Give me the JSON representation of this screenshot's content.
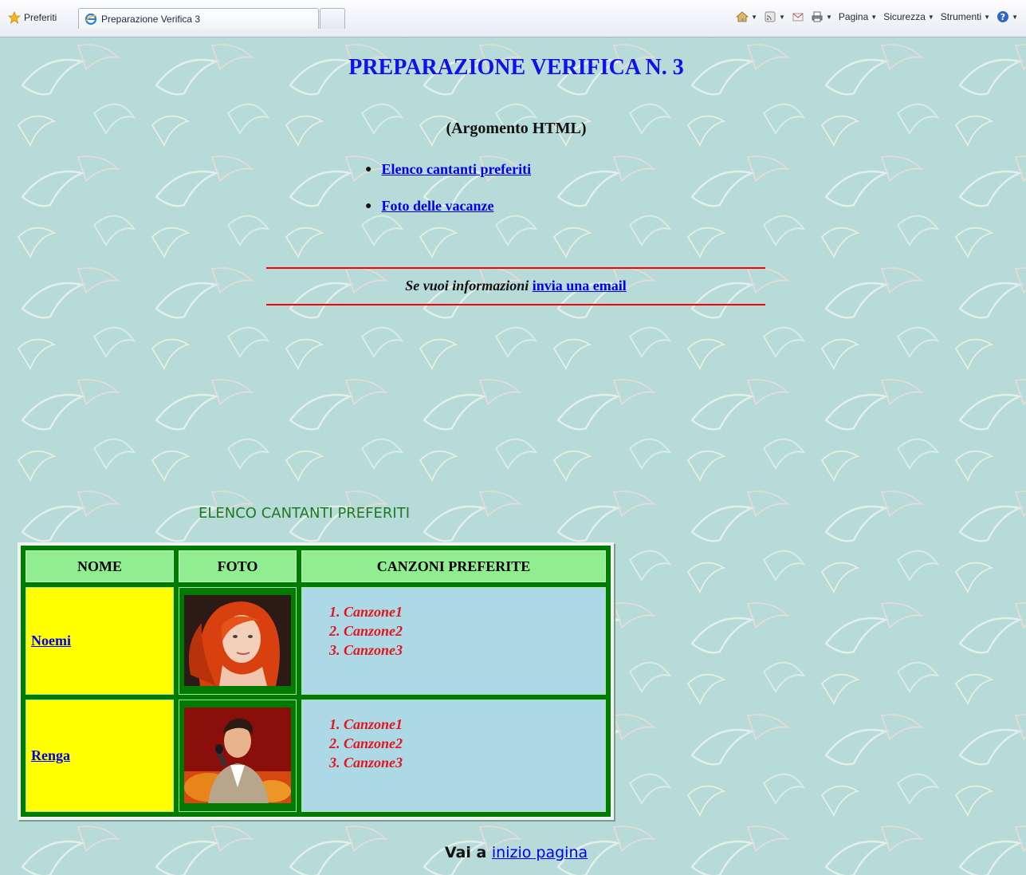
{
  "browser": {
    "favorites_label": "Preferiti",
    "tab_title": "Preparazione Verifica 3",
    "menu": {
      "pagina": "Pagina",
      "sicurezza": "Sicurezza",
      "strumenti": "Strumenti"
    }
  },
  "page": {
    "title": "PREPARAZIONE VERIFICA N. 3",
    "subtitle": "(Argomento HTML)",
    "links": [
      {
        "label": "Elenco cantanti preferiti"
      },
      {
        "label": "Foto delle vacanze"
      }
    ],
    "email_text": "Se vuoi informazioni",
    "email_link": "invia una email",
    "section_heading": "ELENCO CANTANTI PREFERITI",
    "table": {
      "headers": [
        "NOME",
        "FOTO",
        "CANZONI PREFERITE"
      ],
      "rows": [
        {
          "name": "Noemi",
          "songs": [
            "Canzone1",
            "Canzone2",
            "Canzone3"
          ]
        },
        {
          "name": "Renga",
          "songs": [
            "Canzone1",
            "Canzone2",
            "Canzone3"
          ]
        }
      ]
    },
    "back_to_top_text": "Vai a",
    "back_to_top_link": "inizio pagina"
  },
  "colors": {
    "page_bg": "#b7dbd8",
    "title": "#1010ee",
    "link": "#0000ee",
    "rule": "#ff0000",
    "table_border": "#007a00",
    "header_cell": "#90ee90",
    "name_cell": "#ffff00",
    "songs_cell": "#add8e6",
    "song_text": "#e4141c"
  }
}
